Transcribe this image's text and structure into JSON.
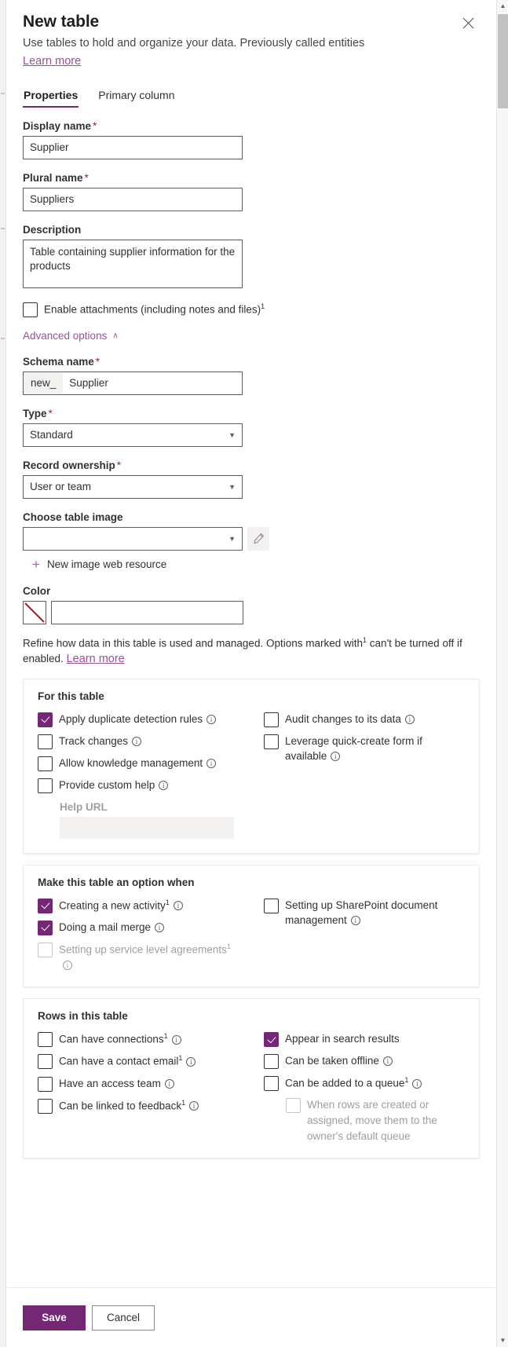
{
  "header": {
    "title": "New table",
    "subtitle": "Use tables to hold and organize your data. Previously called entities",
    "learn_more": "Learn more",
    "close_label": "✕"
  },
  "tabs": [
    {
      "label": "Properties",
      "selected": true
    },
    {
      "label": "Primary column",
      "selected": false
    }
  ],
  "form": {
    "display_name": {
      "label": "Display name",
      "required": "*",
      "value": "Supplier"
    },
    "plural_name": {
      "label": "Plural name",
      "required": "*",
      "value": "Suppliers"
    },
    "description": {
      "label": "Description",
      "value": "Table containing supplier information for the products"
    },
    "enable_attachments": {
      "label": "Enable attachments (including notes and files)",
      "sup": "1",
      "checked": false
    },
    "advanced_options": {
      "label": "Advanced options",
      "expanded": true,
      "caret": "∧"
    },
    "schema_name": {
      "label": "Schema name",
      "required": "*",
      "prefix": "new_",
      "value": "Supplier"
    },
    "type": {
      "label": "Type",
      "required": "*",
      "value": "Standard"
    },
    "record_ownership": {
      "label": "Record ownership",
      "required": "*",
      "value": "User or team"
    },
    "choose_table_image": {
      "label": "Choose table image",
      "value": ""
    },
    "new_image_web_resource": {
      "label": "New image web resource"
    },
    "color": {
      "label": "Color",
      "value": "",
      "swatch_state": "none",
      "swatch_line_color": "#a4262c"
    }
  },
  "refine": {
    "text_before": "Refine how data in this table is used and managed. Options marked with",
    "sup": "1",
    "text_after": "can't be turned off if enabled.",
    "learn_more": "Learn more"
  },
  "cards": [
    {
      "title": "For this table",
      "left": [
        {
          "label": "Apply duplicate detection rules",
          "checked": true,
          "disabled": false,
          "info": true
        },
        {
          "label": "Track changes",
          "checked": false,
          "disabled": false,
          "info": true
        },
        {
          "label": "Allow knowledge management",
          "checked": false,
          "disabled": false,
          "info": true
        },
        {
          "label": "Provide custom help",
          "checked": false,
          "disabled": false,
          "info": true
        }
      ],
      "right": [
        {
          "label": "Audit changes to its data",
          "checked": false,
          "disabled": false,
          "info": true
        },
        {
          "label": "Leverage quick-create form if available",
          "checked": false,
          "disabled": false,
          "info": true
        }
      ],
      "help_url": {
        "label": "Help URL",
        "value": "",
        "disabled": true
      }
    },
    {
      "title": "Make this table an option when",
      "left": [
        {
          "label": "Creating a new activity",
          "sup": "1",
          "checked": true,
          "disabled": false,
          "info": true
        },
        {
          "label": "Doing a mail merge",
          "checked": true,
          "disabled": false,
          "info": true
        },
        {
          "label": "Setting up service level agreements",
          "sup": "1",
          "checked": false,
          "disabled": true,
          "info": true
        }
      ],
      "right": [
        {
          "label": "Setting up SharePoint document management",
          "checked": false,
          "disabled": false,
          "info": true
        }
      ]
    },
    {
      "title": "Rows in this table",
      "left": [
        {
          "label": "Can have connections",
          "sup": "1",
          "checked": false,
          "disabled": false,
          "info": true
        },
        {
          "label": "Can have a contact email",
          "sup": "1",
          "checked": false,
          "disabled": false,
          "info": true
        },
        {
          "label": "Have an access team",
          "checked": false,
          "disabled": false,
          "info": true
        },
        {
          "label": "Can be linked to feedback",
          "sup": "1",
          "checked": false,
          "disabled": false,
          "info": true
        }
      ],
      "right": [
        {
          "label": "Appear in search results",
          "checked": true,
          "disabled": false,
          "info": false
        },
        {
          "label": "Can be taken offline",
          "checked": false,
          "disabled": false,
          "info": true
        },
        {
          "label": "Can be added to a queue",
          "sup": "1",
          "checked": false,
          "disabled": false,
          "info": true
        },
        {
          "label": "When rows are created or assigned, move them to the owner's default queue",
          "checked": false,
          "disabled": true,
          "info": false,
          "indent": true
        }
      ]
    }
  ],
  "footer": {
    "save_label": "Save",
    "cancel_label": "Cancel"
  },
  "theme": {
    "accent": "#742774",
    "link": "#9b4f96",
    "required_red": "#a4262c"
  }
}
